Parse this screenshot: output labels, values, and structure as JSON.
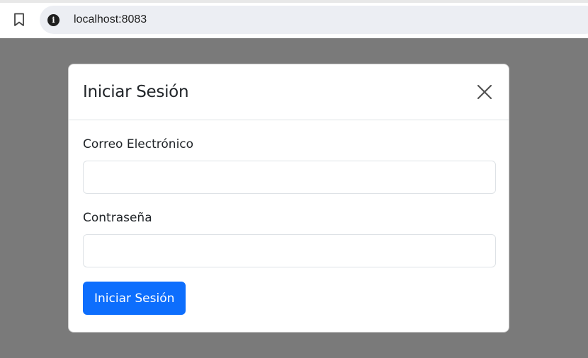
{
  "browser": {
    "url": "localhost:8083",
    "bookmark_icon": "bookmark-icon",
    "info_icon": "info-icon",
    "info_glyph": "i"
  },
  "modal": {
    "title": "Iniciar Sesión",
    "close_icon": "close-icon",
    "email": {
      "label": "Correo Electrónico",
      "value": "",
      "placeholder": ""
    },
    "password": {
      "label": "Contraseña",
      "value": "",
      "placeholder": ""
    },
    "submit_label": "Iniciar Sesión"
  },
  "colors": {
    "backdrop": "#7a7a7a",
    "primary": "#0d6efd",
    "omnibox": "#eceef3"
  }
}
